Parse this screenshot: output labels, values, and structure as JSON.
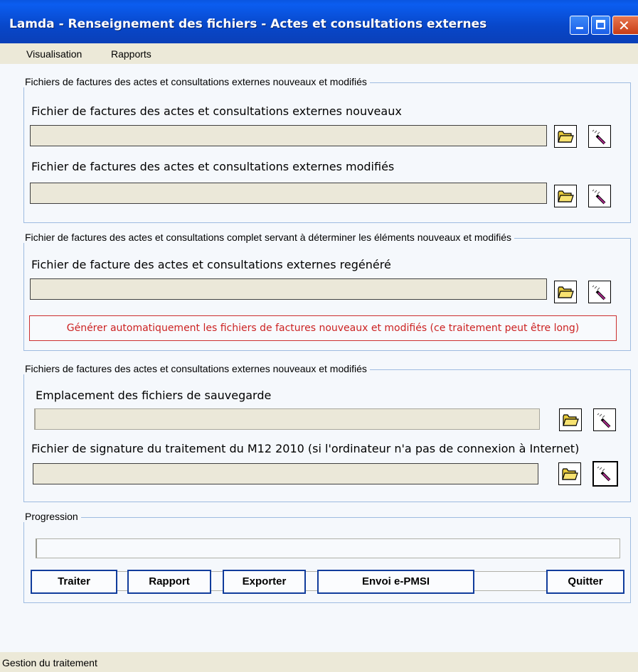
{
  "window": {
    "title": "Lamda - Renseignement des fichiers - Actes et consultations externes"
  },
  "menu": {
    "items": [
      "Visualisation",
      "Rapports"
    ]
  },
  "groups": [
    {
      "legend": "Fichiers de factures des actes et consultations externes nouveaux et modifiés",
      "fields": [
        {
          "label": "Fichier de factures des actes et consultations externes nouveaux",
          "value": ""
        },
        {
          "label": "Fichier de factures des actes et consultations externes modifiés",
          "value": ""
        }
      ]
    },
    {
      "legend": "Fichier de factures des actes et consultations complet servant à déterminer les éléments nouveaux et modifiés",
      "fields": [
        {
          "label": "Fichier de facture des actes et consultations externes regénéré",
          "value": ""
        }
      ],
      "action_label": "Générer automatiquement les fichiers de factures nouveaux et modifiés (ce traitement peut être long)"
    },
    {
      "legend": "Fichiers de factures des actes et consultations externes nouveaux et modifiés",
      "fields": [
        {
          "label": "Emplacement des fichiers de sauvegarde",
          "value": ""
        },
        {
          "label": "Fichier de signature du traitement du M12 2010 (si l'ordinateur n'a pas de connexion à Internet)",
          "value": ""
        }
      ]
    },
    {
      "legend": "Progression"
    }
  ],
  "icons": {
    "browse": "folder-icon",
    "clear": "eraser-wand-icon"
  },
  "buttons": {
    "traiter": "Traiter",
    "rapport": "Rapport",
    "exporter": "Exporter",
    "envoi": "Envoi e-PMSI",
    "quitter": "Quitter"
  },
  "status": {
    "text": "Gestion du traitement"
  },
  "colors": {
    "title_bar": "#0a49d0",
    "group_border": "#9ebbe0",
    "warning_text": "#cc2222",
    "button_border": "#103c9c"
  }
}
